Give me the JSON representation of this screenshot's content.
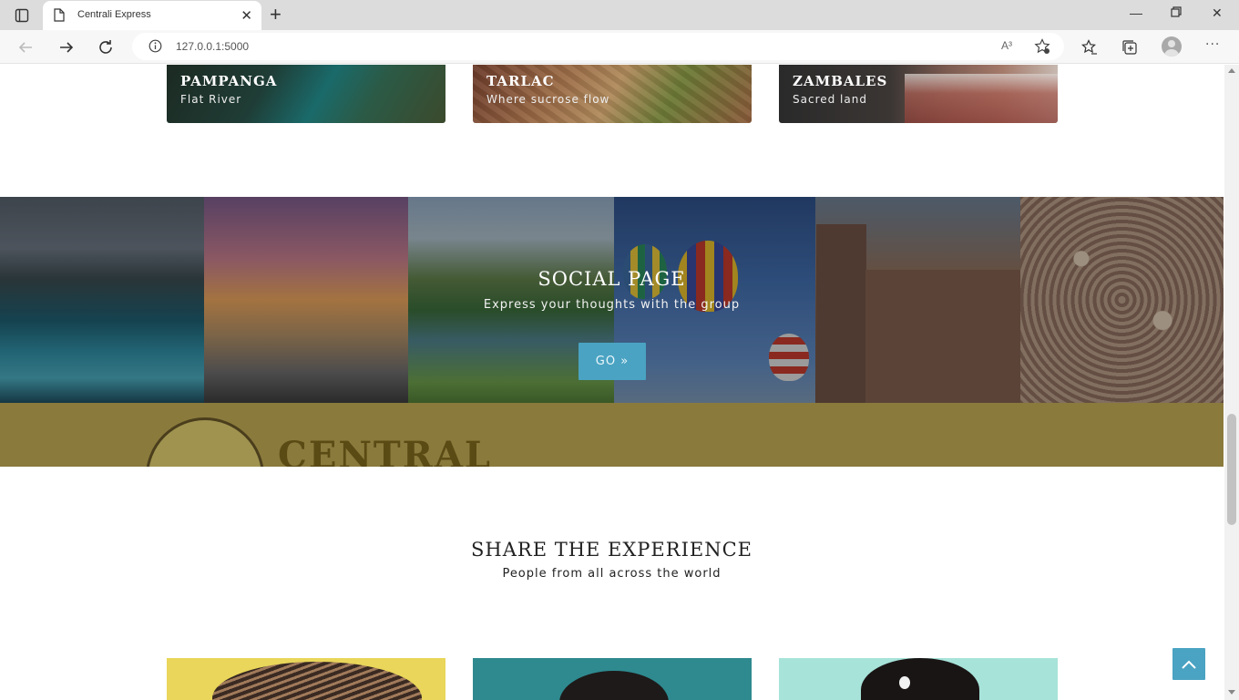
{
  "browser": {
    "tab_title": "Centrali Express",
    "url": "127.0.0.1:5000",
    "read_aloud": "A³"
  },
  "provinces": [
    {
      "name": "PAMPANGA",
      "tagline": "Flat River"
    },
    {
      "name": "TARLAC",
      "tagline": "Where sucrose flow"
    },
    {
      "name": "ZAMBALES",
      "tagline": "Sacred land"
    }
  ],
  "social": {
    "title": "SOCIAL PAGE",
    "subtitle": "Express your thoughts with the group",
    "button_label": "GO »",
    "banner_logo_text": "CENTRAL"
  },
  "share": {
    "title": "SHARE THE EXPERIENCE",
    "subtitle": "People from all across the world"
  },
  "colors": {
    "accent": "#4aa3c2"
  }
}
